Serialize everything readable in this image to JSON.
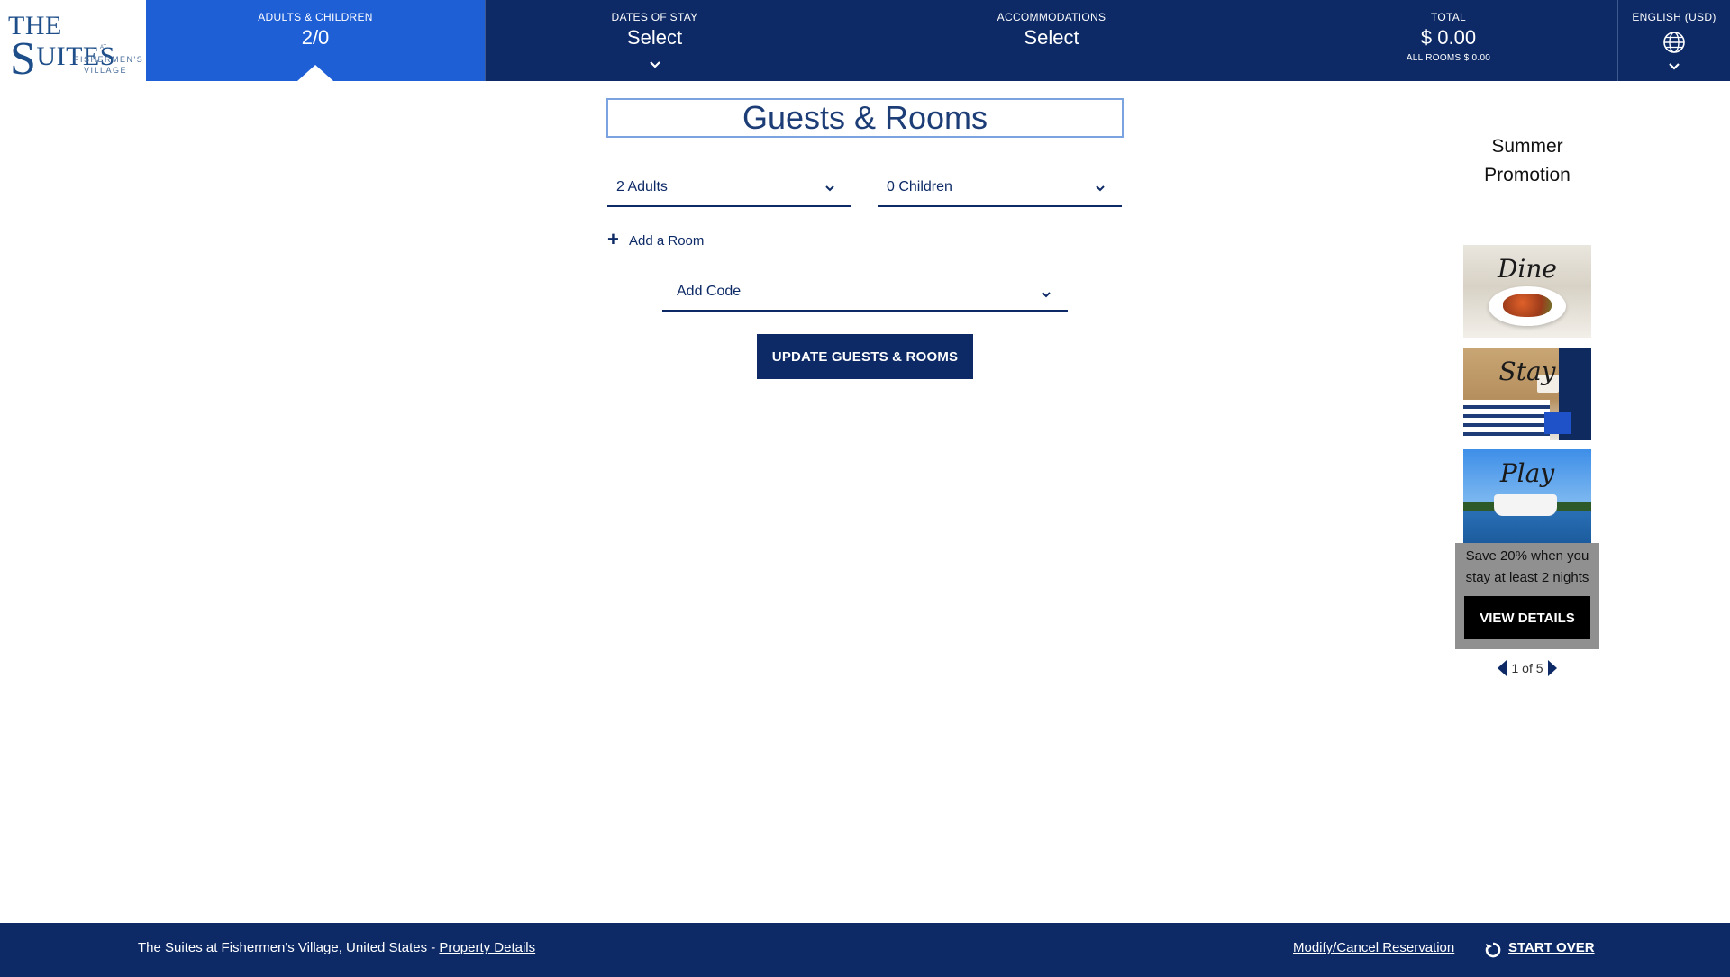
{
  "logo": {
    "main_left": "THE ",
    "main_big": "S",
    "main_right": "UITES",
    "at": "AT",
    "line1": "FISHERMEN'S",
    "line2": "VILLAGE"
  },
  "header": {
    "adults_children": {
      "label": "ADULTS & CHILDREN",
      "value": "2/0"
    },
    "dates": {
      "label": "DATES OF STAY",
      "value": "Select"
    },
    "accommodations": {
      "label": "ACCOMMODATIONS",
      "value": "Select"
    },
    "total": {
      "label": "TOTAL",
      "value": "$ 0.00",
      "sub": "ALL ROOMS $ 0.00"
    },
    "language": {
      "label": "ENGLISH (USD)"
    }
  },
  "form": {
    "title": "Guests & Rooms",
    "adults": "2 Adults",
    "children": "0 Children",
    "add_room": "Add a Room",
    "add_code": "Add Code",
    "update_button": "UPDATE GUESTS & ROOMS"
  },
  "promo": {
    "title_line1": "Summer",
    "title_line2": "Promotion",
    "tiles": [
      "Dine",
      "Stay",
      "Play"
    ],
    "text_line1": "Save 20% when you",
    "text_line2": "stay at least 2 nights",
    "button": "VIEW DETAILS",
    "pager": "1 of 5"
  },
  "footer": {
    "property": "The Suites at Fishermen's Village, United States - ",
    "property_details": "Property Details",
    "modify": "Modify/Cancel Reservation",
    "start_over": "START OVER"
  },
  "colors": {
    "navy": "#0d2a66",
    "active_blue": "#1f5fd6",
    "promo_overlay": "#909090"
  }
}
